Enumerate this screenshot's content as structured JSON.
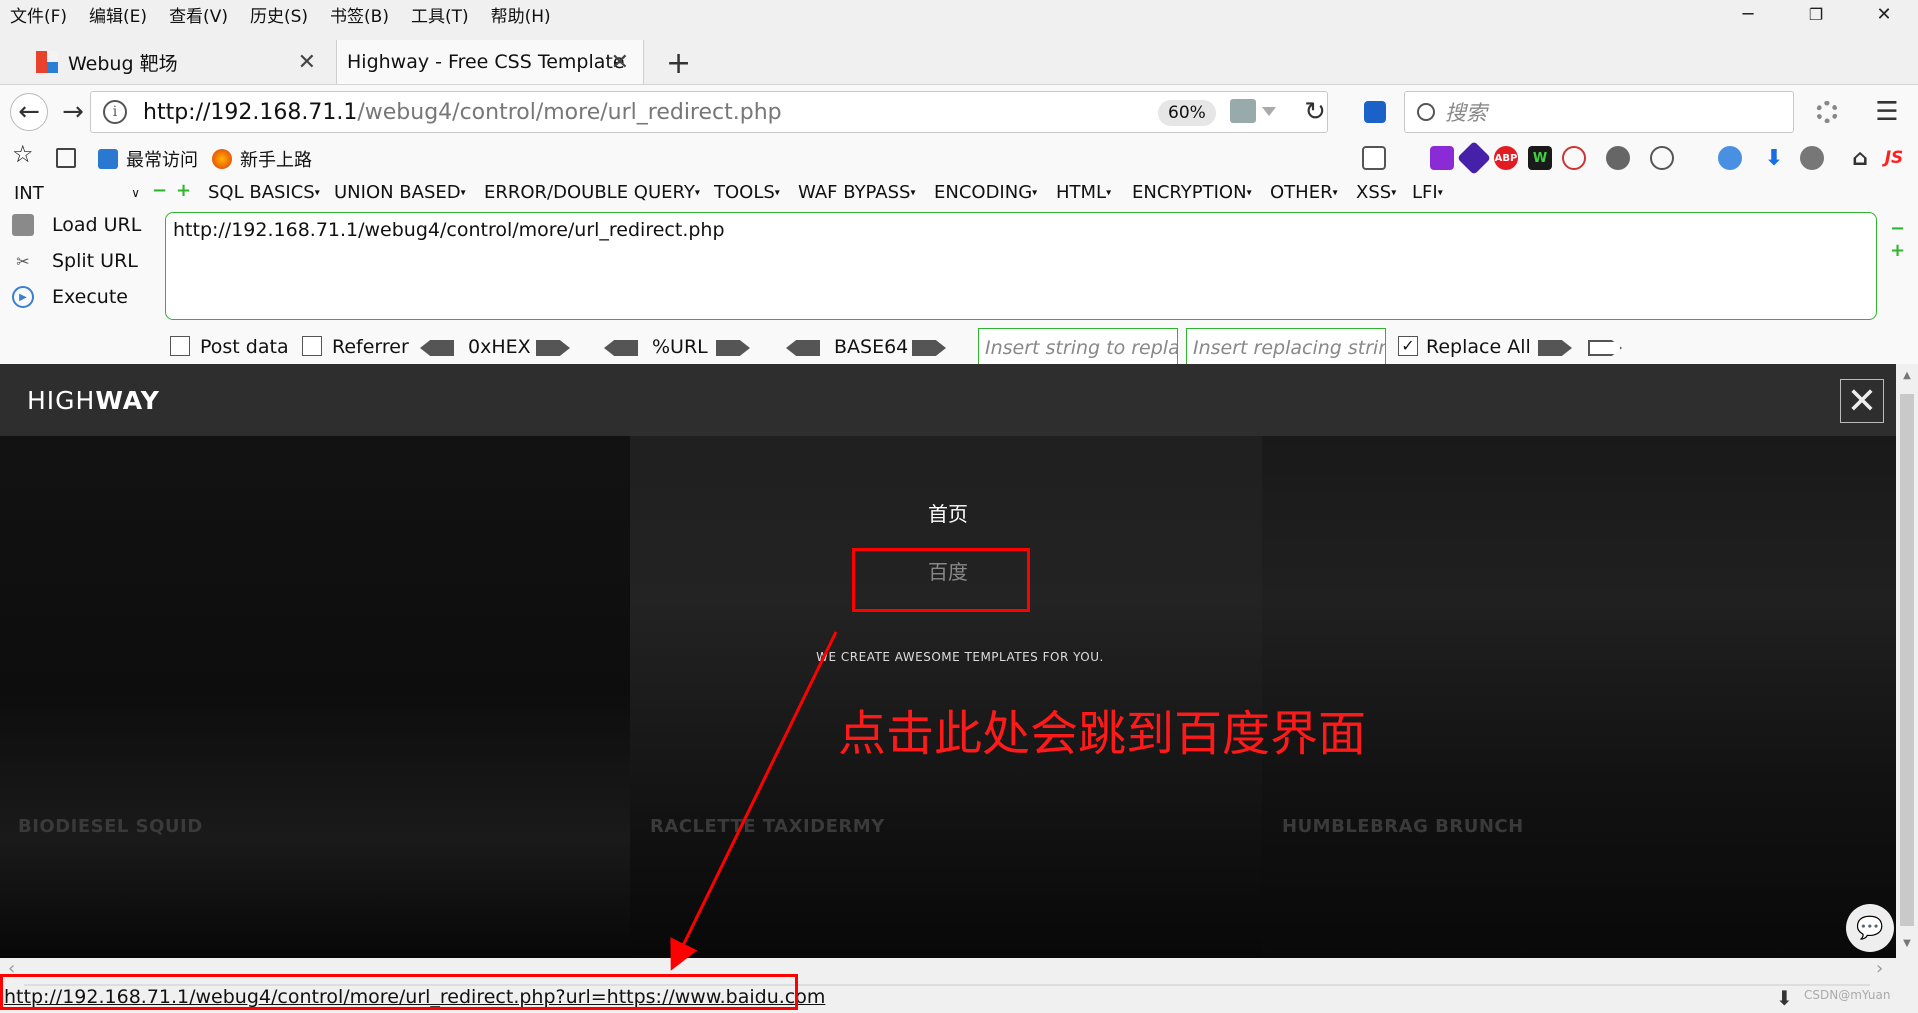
{
  "menubar": {
    "items": [
      "文件(F)",
      "编辑(E)",
      "查看(V)",
      "历史(S)",
      "书签(B)",
      "工具(T)",
      "帮助(H)"
    ],
    "window_controls": [
      "─",
      "❐",
      "✕"
    ]
  },
  "tabs": [
    {
      "title": "Webug 靶场",
      "close": "✕"
    },
    {
      "title": "Highway - Free CSS Template",
      "close": "✕"
    }
  ],
  "new_tab": "+",
  "navbar": {
    "back": "←",
    "forward": "→",
    "info": "i",
    "url_host": "http://192.168.71.1",
    "url_path": "/webug4/control/more/url_redirect.php",
    "zoom": "60%",
    "reload": "↻",
    "search_placeholder": "搜索",
    "menu": "☰"
  },
  "bookmarks": {
    "star": "☆",
    "items": [
      "最常访问",
      "新手上路"
    ]
  },
  "toolbar_icons": [
    {
      "name": "abp-icon",
      "label": "ABP",
      "color": "#e31b23"
    },
    {
      "name": "js-icon",
      "label": "JS",
      "color": "#ff2020"
    }
  ],
  "hackbar": {
    "int_select": "INT",
    "menu_items": [
      "SQL BASICS",
      "UNION BASED",
      "ERROR/DOUBLE QUERY",
      "TOOLS",
      "WAF BYPASS",
      "ENCODING",
      "HTML",
      "ENCRYPTION",
      "OTHER",
      "XSS",
      "LFI"
    ],
    "actions": [
      "Load URL",
      "Split URL",
      "Execute"
    ],
    "url_value": "http://192.168.71.1/webug4/control/more/url_redirect.php",
    "post_data": "Post data",
    "referrer": "Referrer",
    "hex": "0xHEX",
    "url_enc": "%URL",
    "base64": "BASE64",
    "replace_placeholder": "Insert string to replace",
    "replacing_placeholder": "Insert replacing string",
    "replace_all": "Replace All",
    "replace_all_checked": "✓",
    "plus": "+",
    "minus": "−"
  },
  "site": {
    "logo_light": "HIGH",
    "logo_bold": "WAY",
    "close": "✕",
    "nav_home": "首页",
    "nav_baidu": "百度",
    "tagline": "WE CREATE AWESOME TEMPLATES FOR YOU.",
    "captions": [
      "BIODIESEL SQUID",
      "RACLETTE TAXIDERMY",
      "HUMBLEBRAG BRUNCH"
    ],
    "chat": "💬"
  },
  "annotation": {
    "text": "点击此处会跳到百度界面",
    "color": "#ff1a1a"
  },
  "statusbar": {
    "link": "http://192.168.71.1/webug4/control/more/url_redirect.php?url=https://www.baidu.com",
    "watermark": "CSDN@mYuan"
  },
  "colors": {
    "hackbar_green": "#2fb52f",
    "page_header": "#2e2e2e",
    "annotation_red": "#ff0000"
  }
}
